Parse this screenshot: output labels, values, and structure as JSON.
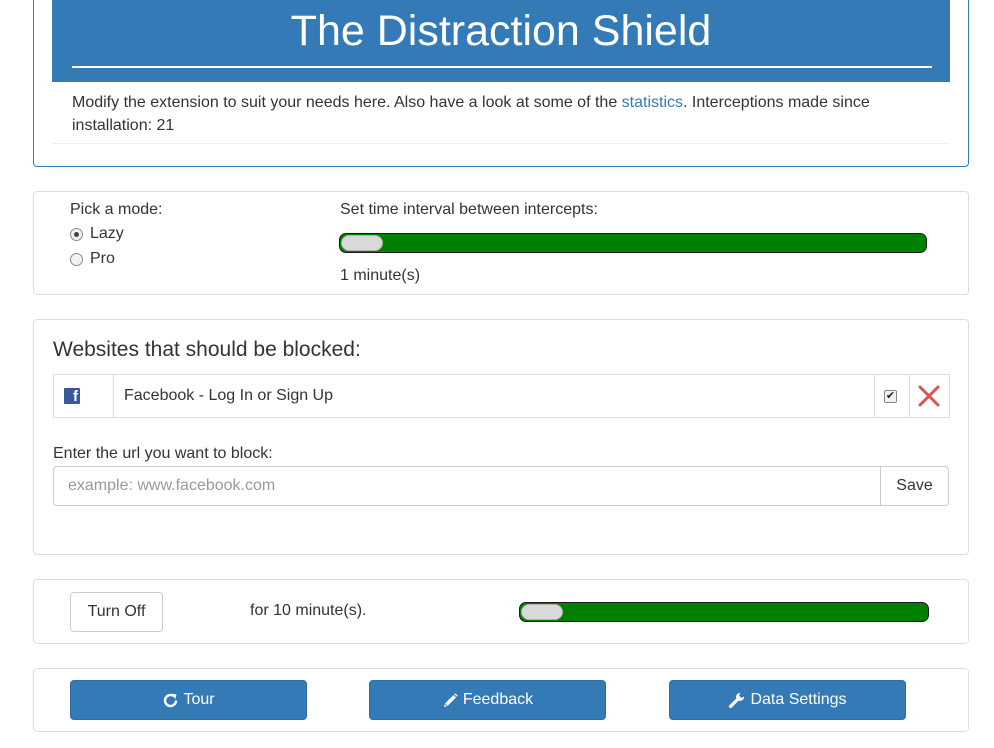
{
  "header": {
    "title": "The Distraction Shield",
    "intro_before_link": "Modify the extension to suit your needs here. Also have a look at some of the ",
    "statistics_link": "statistics",
    "intro_after_link": ". Interceptions made since installation: 21"
  },
  "mode": {
    "pick_label": "Pick a mode:",
    "options": [
      {
        "label": "Lazy",
        "checked": true
      },
      {
        "label": "Pro",
        "checked": false
      }
    ],
    "interval_label": "Set time interval between intercepts:",
    "interval_value_text": "1 minute(s)"
  },
  "blocked": {
    "title": "Websites that should be blocked:",
    "sites": [
      {
        "icon": "facebook-icon",
        "name": "Facebook - Log In or Sign Up",
        "enabled": true
      }
    ],
    "input_label": "Enter the url you want to block:",
    "input_placeholder": "example: www.facebook.com",
    "save_label": "Save"
  },
  "turnoff": {
    "button_label": "Turn Off",
    "duration_text": "for 10 minute(s)."
  },
  "actions": {
    "tour_label": "Tour",
    "feedback_label": "Feedback",
    "data_settings_label": "Data Settings"
  },
  "colors": {
    "primary": "#337ab7",
    "slider_fill": "#008000",
    "delete": "#d9534f"
  }
}
